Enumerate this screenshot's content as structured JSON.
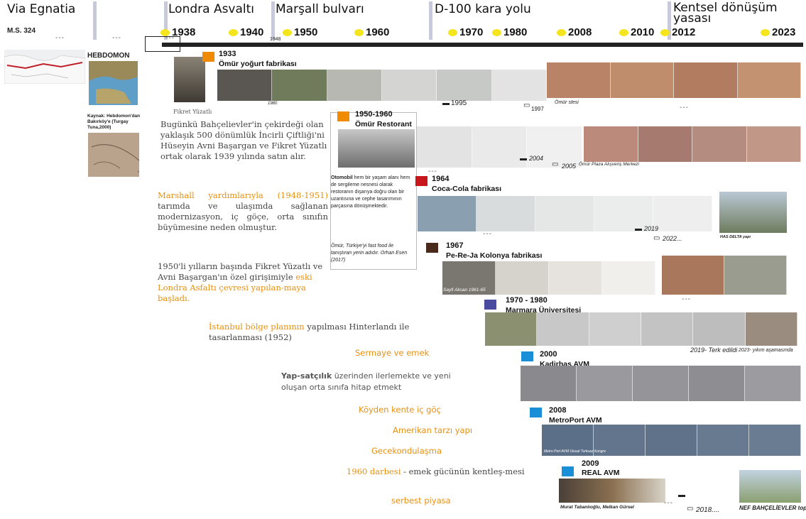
{
  "eras": [
    "Via Egnatia",
    "Londra Asvaltı",
    "Marşall bulvarı",
    "D-100 kara yolu",
    "Kentsel dönüşüm",
    "yasası"
  ],
  "ms": "M.S. 324",
  "dashes": "---",
  "years": [
    "1938",
    "1940",
    "1950",
    "1960",
    "1970",
    "1980",
    "2008",
    "2010",
    "2012",
    "2023"
  ],
  "small1948": "1948",
  "hebdomon": "HEBDOMON",
  "kaynak": "Kaynak: Hebdomon'dan Bakırköy'e (Turgay Tuna,2000)",
  "fikret": "Fikret Yüzatlı",
  "events": {
    "e1933": {
      "year": "1933",
      "title": "Ömür yoğurt fabrikası"
    },
    "e1950": {
      "year": "1950-1960",
      "title": "Ömür Restorant"
    },
    "e1964": {
      "year": "1964",
      "title": "Coca-Cola fabrikası"
    },
    "e1967": {
      "year": "1967",
      "title": "Pe-Re-Ja Kolonya fabrikası"
    },
    "e1970": {
      "year": "1970 - 1980",
      "title": "Marmara Üniversitesi"
    },
    "e2000": {
      "year": "2000",
      "title": "Kadirhas AVM"
    },
    "e2008": {
      "year": "2008",
      "title": "MetroPort AVM"
    },
    "e2009": {
      "year": "2009",
      "title": "REAL AVM"
    }
  },
  "captions": {
    "c1980": "1980",
    "c1995": "1995",
    "c1997": "1997",
    "omurstesi": "Ömür stesi",
    "c2004": "2004",
    "c2005": "2005",
    "omurplaza": "Ömür Plaza Alışveriş Merkezi",
    "c2019": "2019",
    "c2022": "2022...",
    "hasdelta": "HAS DELTA yapı",
    "sayfi": "Sayfi Aksan 1961-65",
    "terk": "2019- Terk edildi",
    "yikim": "2023- yıkım aşamasında",
    "metroport": "Metro Port AVM Ulusal Turkuaz Kongre",
    "murat": "Murat Tabanlıoğlu, Melkan Gürsel",
    "c2018": "2018....",
    "nef": "NEF BAHÇELİEVLER toplu konu"
  },
  "para1": "Bugünkü Bahçelievler'in çekirdeği olan yaklaşık 500 dönümlük İncirli Çiftliği'ni Hüseyin Avni Başargan ve Fikret Yüzatlı ortak olarak 1939 yılında satın alır.",
  "para2_or": "Marshall yardımlarıyla (1948-1951)",
  "para2": " tarımda ve ulaşımda sağlanan modernizasyon, iç göçe, orta sınıfın büyümesine neden olmuştur.",
  "para3a": "1950'li yılların başında Fikret Yüzatlı ve Avni Başargan'ın özel girişimiyle ",
  "para3_or": "eski Londra Asfaltı çevresi yapılan-maya başladı.",
  "para4_or": "İstanbul bölge planının",
  "para4": " yapılması Hinterlandı ile tasarlanması (1952)",
  "sermaye": "Sermaye ve emek",
  "yapsatcilik_b": "Yap-satçılık",
  "yapsatcilik": " üzerinden ilerlemekte ve yeni oluşan orta sınıfa hitap etmekt",
  "koyden": "Köyden kente iç göç",
  "amerikan": "Amerikan tarzı yapı",
  "gecekondu": "Gecekondulaşma",
  "darbe_or": "1960 darbesi",
  "darbe": " - emek gücünün kentleş-mesi",
  "serbest": "serbest piyasa",
  "box_b": "Otomobil",
  "box1": " hem bir yaşam alanı hem de sergileme nesnesi olarak restoranın dışarıya doğru olan bir uzantısına ve cephe tasarımının parçasına dönüşmektedir.",
  "box2": "Ömür, Türkiye'yi fast food ile tanıştıran yerin adıdır. Orhan Esen (2017)",
  "colors": {
    "accent": "#e8900f",
    "dot": "#f5e51c",
    "orange": "#f08a00",
    "red": "#c8161d",
    "brown": "#4a2a1a",
    "indigo": "#4a4a9e",
    "blue": "#1a8fd8"
  }
}
